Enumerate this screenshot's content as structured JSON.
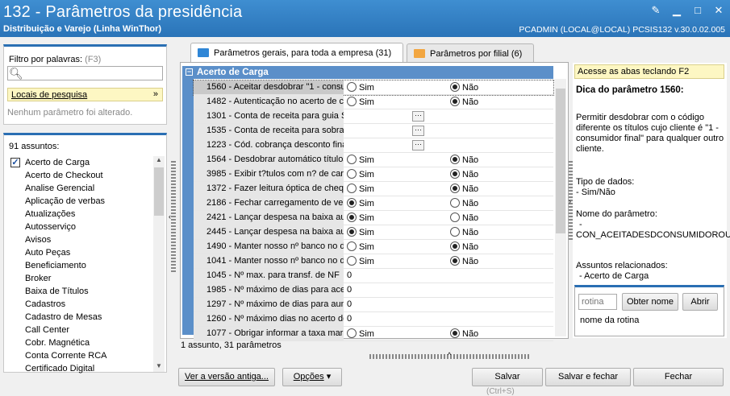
{
  "window": {
    "title": "132 - Parâmetros da presidência",
    "subtitle": "Distribuição e Varejo (Linha WinThor)",
    "info": "PCADMIN (LOCAL@LOCAL)   PCSIS132  v.30.0.02.005"
  },
  "filter": {
    "label": "Filtro por palavras:",
    "shortcut": "(F3)",
    "search_value": "",
    "locais_label": "Locais de pesquisa",
    "nenhum": "Nenhum parâmetro foi alterado."
  },
  "assuntos": {
    "count_label": "91 assuntos:",
    "items": [
      {
        "label": "Acerto de Carga",
        "checked": true
      },
      {
        "label": "Acerto de Checkout"
      },
      {
        "label": "Analise Gerencial"
      },
      {
        "label": "Aplicação de verbas"
      },
      {
        "label": "Atualizações"
      },
      {
        "label": "Autosserviço"
      },
      {
        "label": "Avisos"
      },
      {
        "label": "Auto Peças"
      },
      {
        "label": "Beneficiamento"
      },
      {
        "label": "Broker"
      },
      {
        "label": "Baixa de Títulos"
      },
      {
        "label": "Cadastros"
      },
      {
        "label": "Cadastro de Mesas"
      },
      {
        "label": "Call Center"
      },
      {
        "label": "Cobr. Magnética"
      },
      {
        "label": "Conta Corrente RCA"
      },
      {
        "label": "Certificado Digital"
      }
    ]
  },
  "tabs": [
    {
      "label": "Parâmetros gerais, para toda a empresa",
      "count": "(31)",
      "active": true
    },
    {
      "label": "Parâmetros por filial",
      "count": "(6)",
      "active": false
    }
  ],
  "grid": {
    "group_header": "Acerto de Carga",
    "sim_label": "Sim",
    "nao_label": "Não",
    "rows": [
      {
        "name": "1560 - Aceitar desdobrar \"1 - consu",
        "type": "radio",
        "value": "nao",
        "selected": true
      },
      {
        "name": "1482 - Autenticação no acerto de c",
        "type": "radio",
        "value": "nao"
      },
      {
        "name": "1301 - Conta de receita para guia S",
        "type": "lookup"
      },
      {
        "name": "1535 - Conta de receita para sobra",
        "type": "lookup"
      },
      {
        "name": "1223 - Cód. cobrança desconto fina",
        "type": "lookup"
      },
      {
        "name": "1564 - Desdobrar automático títulos",
        "type": "radio",
        "value": "nao"
      },
      {
        "name": "3985 - Exibir t?tulos com n? de carr",
        "type": "radio",
        "value": "nao"
      },
      {
        "name": "1372 - Fazer leitura óptica de chequ",
        "type": "radio",
        "value": "nao"
      },
      {
        "name": "2186 - Fechar carregamento de ver",
        "type": "radio",
        "value": "sim"
      },
      {
        "name": "2421 - Lançar despesa na baixa au",
        "type": "radio",
        "value": "sim"
      },
      {
        "name": "2445 - Lançar despesa na baixa au",
        "type": "radio",
        "value": "sim"
      },
      {
        "name": "1490 - Manter nosso nº banco no d",
        "type": "radio",
        "value": "nao"
      },
      {
        "name": "1041 - Manter nosso nº banco no d",
        "type": "radio",
        "value": "nao"
      },
      {
        "name": "1045 - Nº max. para transf. de NF",
        "type": "number",
        "value": "0"
      },
      {
        "name": "1985 - Nº máximo de dias para acer",
        "type": "number",
        "value": "0"
      },
      {
        "name": "1297 - Nº máximo de dias para aum",
        "type": "number",
        "value": "0"
      },
      {
        "name": "1260 - Nº máximo dias no acerto de",
        "type": "number",
        "value": "0"
      },
      {
        "name": "1077 - Obrigar informar a taxa mar",
        "type": "radio",
        "value": "nao"
      }
    ]
  },
  "status_text": "1 assunto, 31 parâmetros",
  "help": {
    "acesse": "Acesse as abas teclando F2",
    "title": "Dica do parâmetro 1560:",
    "description": "Permitir desdobrar com o código diferente os títulos cujo cliente é \"1 - consumidor final\" para qualquer outro cliente.",
    "tipo_label": "Tipo de dados:",
    "tipo_value": "- Sim/Não",
    "nome_label": "Nome do parâmetro:",
    "nome_value_prefix": "-",
    "nome_value": "CON_ACEITADESDCONSUMIDOROUT",
    "assuntos_label": "Assuntos relacionados:",
    "assuntos_value": "- Acerto de Carga",
    "rotina_placeholder": "rotina",
    "obter_nome": "Obter nome",
    "abrir": "Abrir",
    "nome_rotina": "nome da rotina"
  },
  "buttons": {
    "versao_antiga": "Ver a versão antiga...",
    "opcoes": "Opções",
    "salvar": "Salvar",
    "salvar_fechar": "Salvar e fechar",
    "fechar": "Fechar",
    "shortcut_hint": "(Ctrl+S)"
  },
  "colors": {
    "title_blue": "#2a74b8",
    "group_blue": "#5b8fc9",
    "hint_yellow": "#fdf7c3"
  }
}
